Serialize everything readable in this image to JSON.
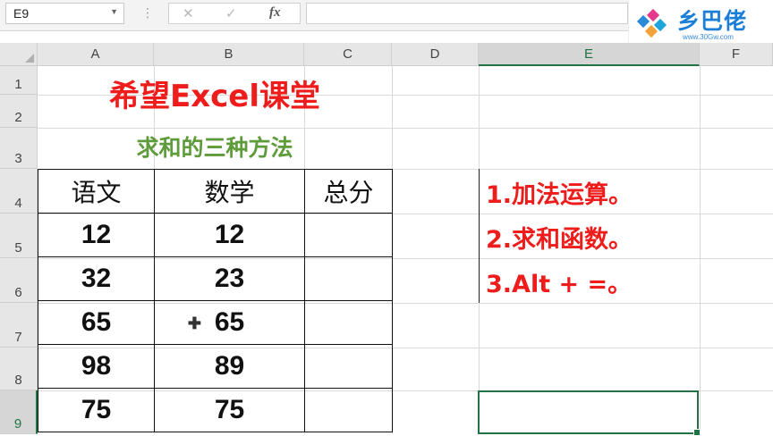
{
  "formula_bar": {
    "name_box": "E9",
    "cancel_icon": "✕",
    "enter_icon": "✓",
    "fx_label": "fx",
    "formula_value": ""
  },
  "logo": {
    "brand": "乡巴佬",
    "url": "www.30Gw.com"
  },
  "columns": [
    "A",
    "B",
    "C",
    "D",
    "E",
    "F"
  ],
  "rows": [
    "1",
    "2",
    "3",
    "4",
    "5",
    "6",
    "7",
    "8",
    "9"
  ],
  "selected": {
    "column": "E",
    "row": "9"
  },
  "sheet": {
    "title": "希望Excel课堂",
    "subtitle": "求和的三种方法",
    "table": {
      "headers": [
        "语文",
        "数学",
        "总分"
      ],
      "rows": [
        [
          "12",
          "12",
          ""
        ],
        [
          "32",
          "23",
          ""
        ],
        [
          "65",
          "65",
          ""
        ],
        [
          "98",
          "89",
          ""
        ],
        [
          "75",
          "75",
          ""
        ]
      ]
    },
    "notes": [
      "1.加法运算。",
      "2.求和函数。",
      "3.Alt + =。"
    ]
  },
  "colors": {
    "title": "#ef1c1c",
    "subtitle": "#5e9b3a",
    "selection": "#217346"
  }
}
